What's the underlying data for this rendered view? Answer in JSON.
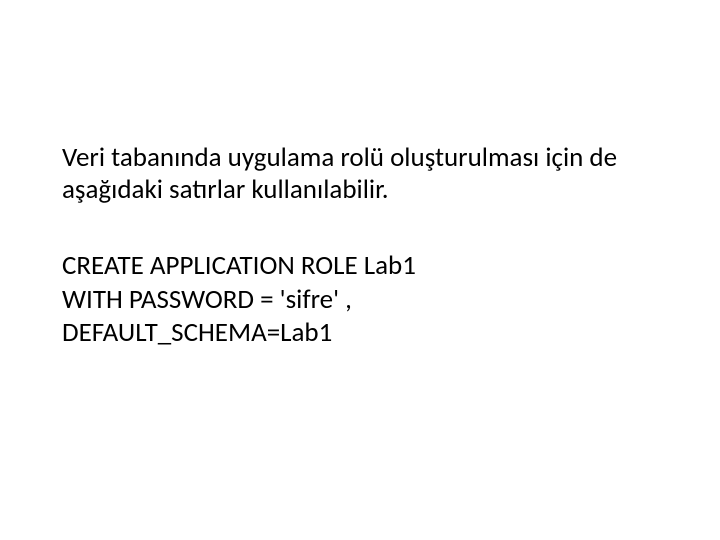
{
  "intro": "Veri tabanında uygulama rolü oluşturulması için de aşağıdaki satırlar kullanılabilir.",
  "code": {
    "line1": "CREATE APPLICATION ROLE Lab1",
    "line2": "WITH PASSWORD = 'sifre' ,",
    "line3": "DEFAULT_SCHEMA=Lab1"
  }
}
